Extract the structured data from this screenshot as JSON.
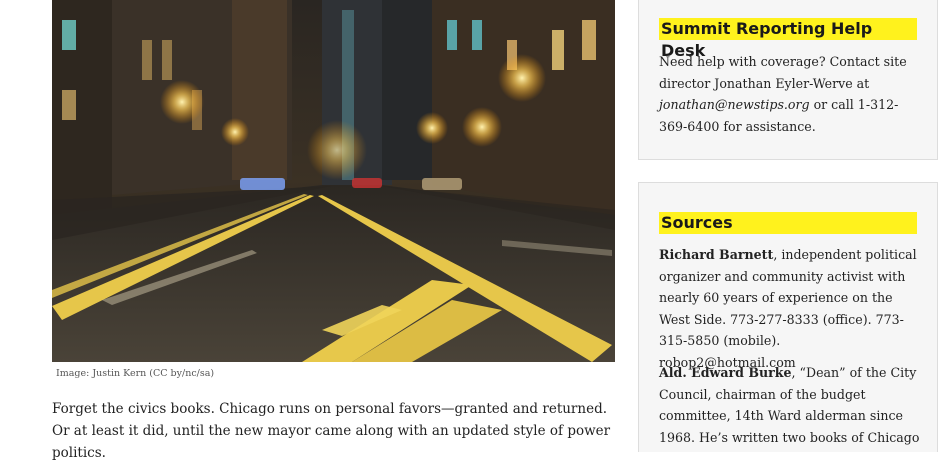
{
  "image": {
    "caption": "Image: Justin Kern (CC by/nc/sa)"
  },
  "article": {
    "paragraph1": "Forget the civics books. Chicago runs on personal favors—granted and returned. Or at least it did, until the new mayor came along with an updated style of power politics."
  },
  "sidebar": {
    "help_desk": {
      "title": "Summit Reporting Help Desk",
      "text_before_email": "Need help with coverage? Contact site director Jonathan Eyler-Werve at ",
      "email": "jonathan@newstips.org",
      "text_after_email": " or call 1-312-369-6400 for assistance."
    },
    "sources": {
      "title": "Sources",
      "entries": [
        {
          "name": "Richard Barnett",
          "description": ", independent political organizer and community activist with nearly 60 years of experience on the West Side. 773-277-8333 (office). 773-315-5850 (mobile). robop2@hotmail.com"
        },
        {
          "name": "Ald. Edward Burke",
          "description": ", “Dean” of the City Council, chairman of the budget committee, 14th Ward alderman since 1968. He’s written two books of Chicago"
        }
      ]
    }
  }
}
